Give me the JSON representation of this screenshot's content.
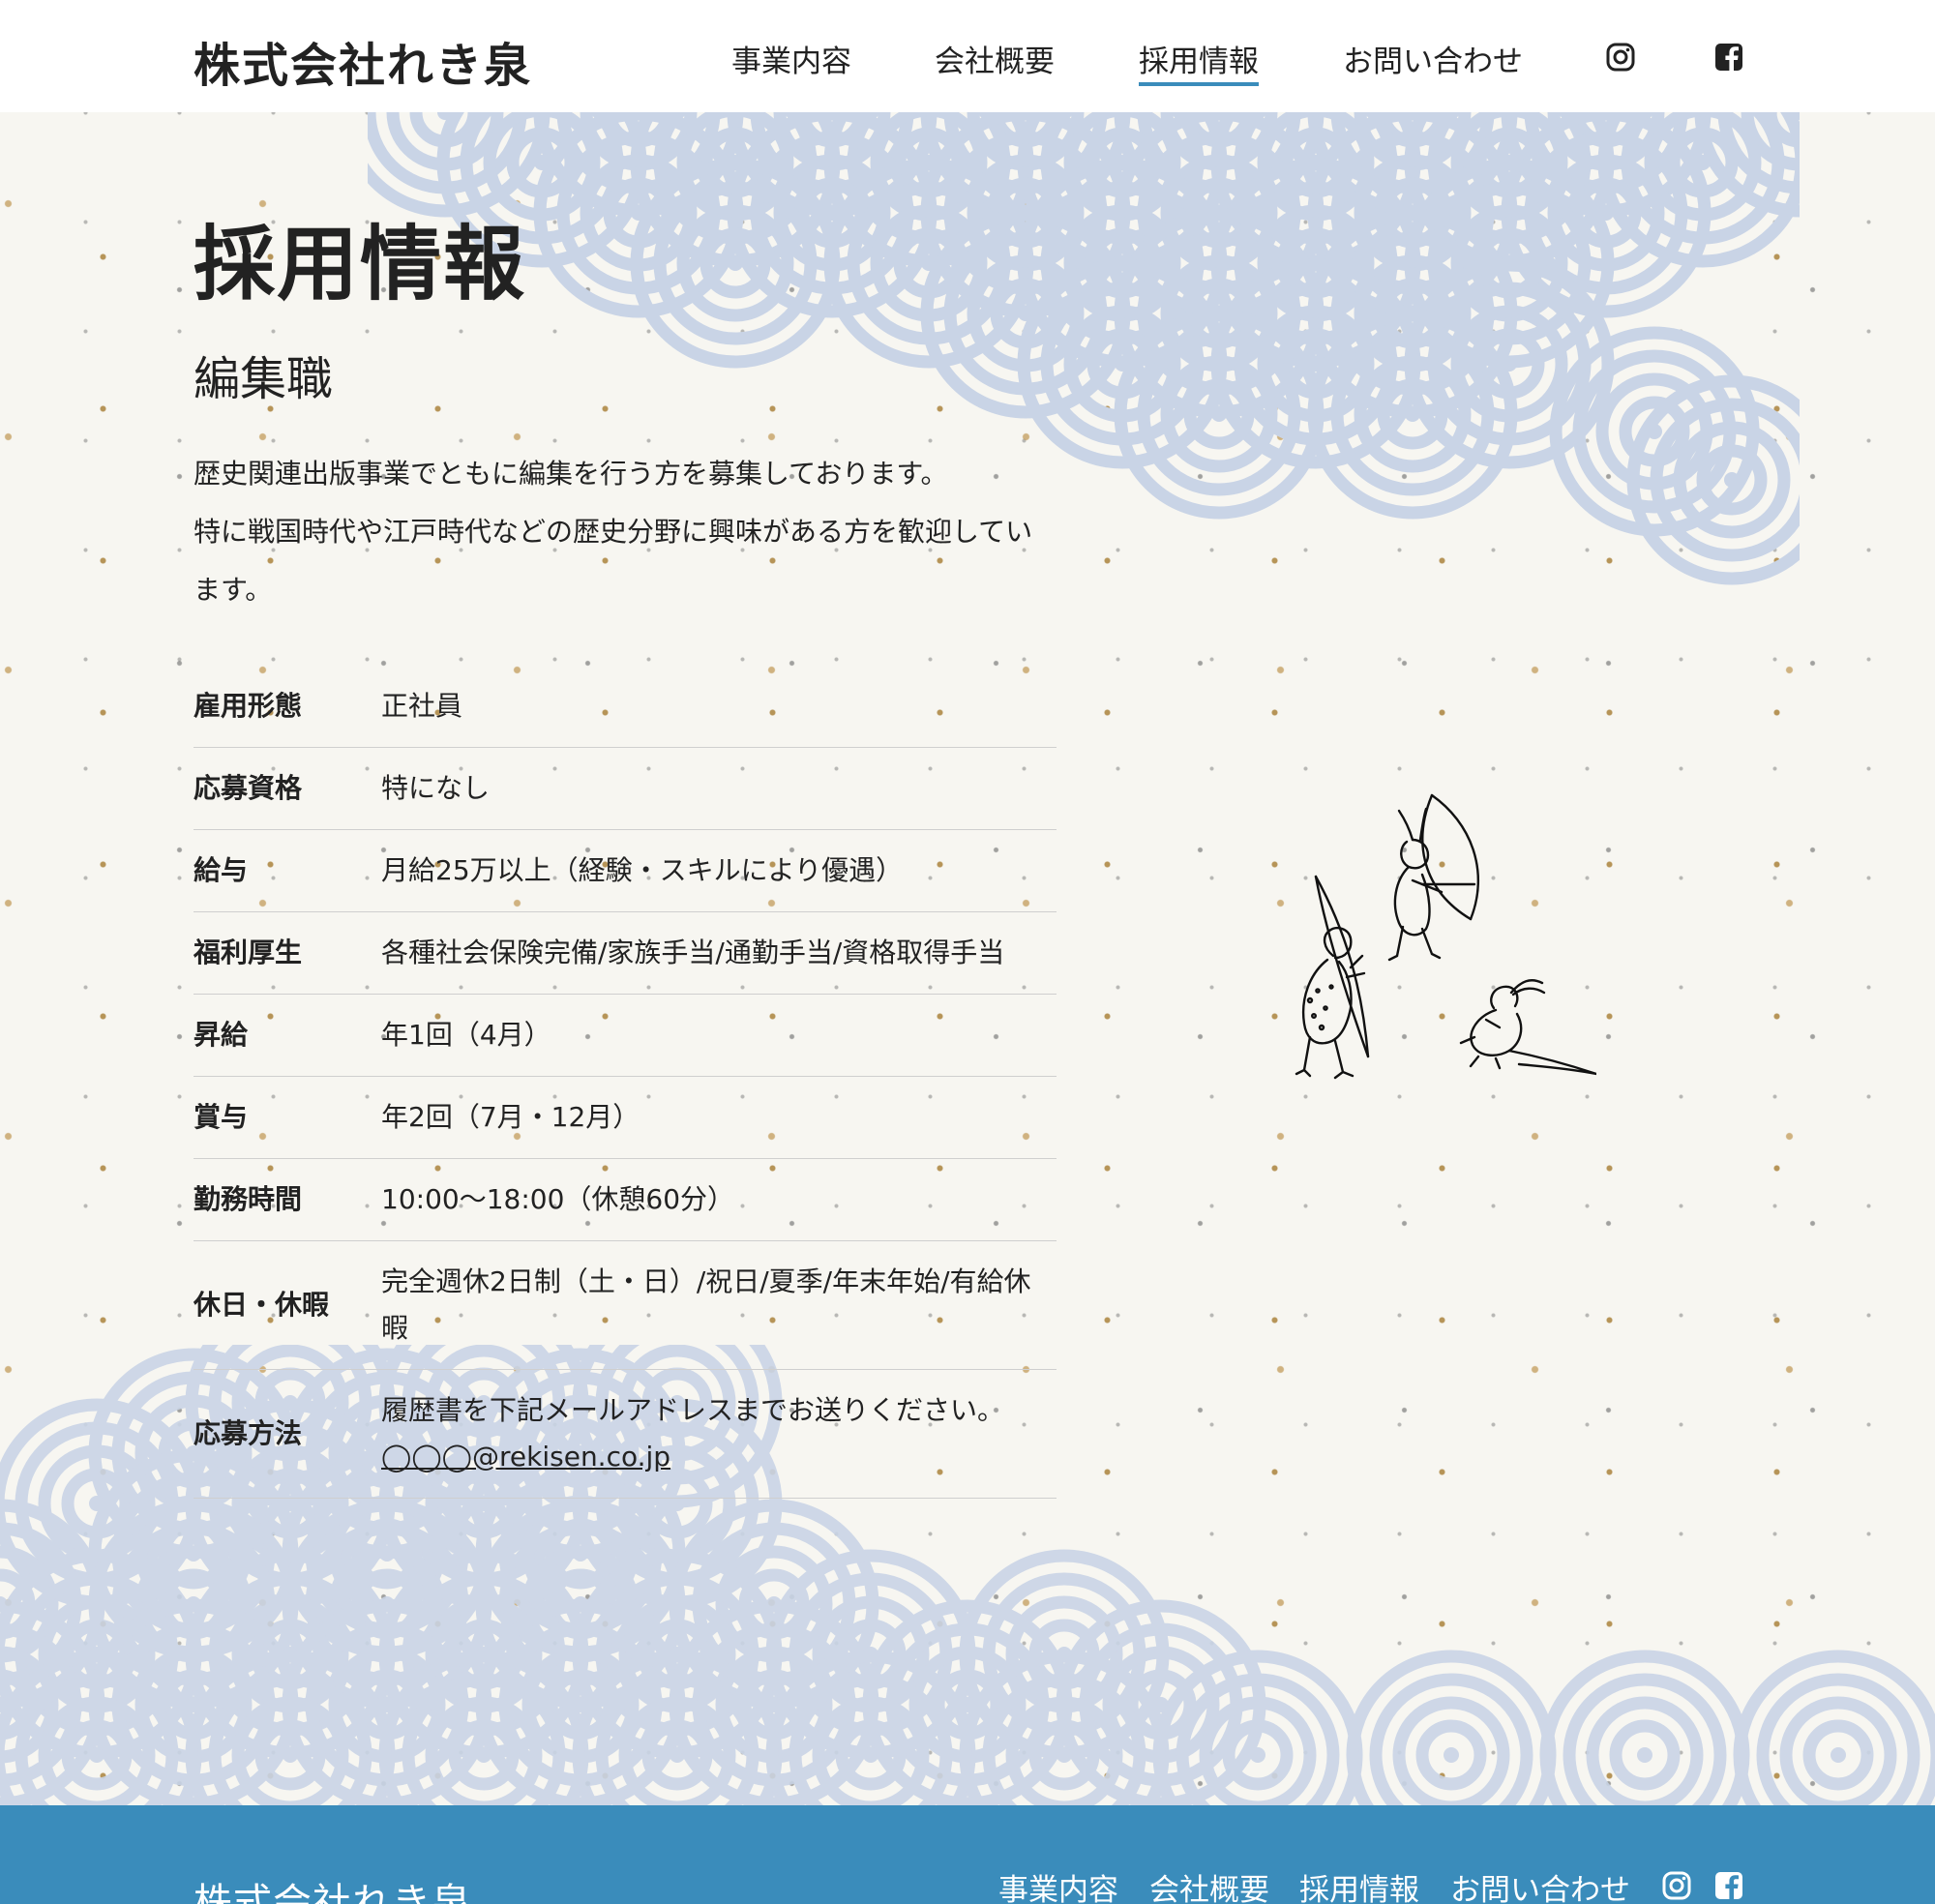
{
  "header": {
    "logo": "株式会社れき泉",
    "nav": [
      "事業内容",
      "会社概要",
      "採用情報",
      "お問い合わせ"
    ],
    "active_nav": "採用情報",
    "icons": [
      "instagram-icon",
      "facebook-icon"
    ]
  },
  "main": {
    "title": "採用情報",
    "job_title": "編集職",
    "description": [
      "歴史関連出版事業でともに編集を行う方を募集しております。",
      "特に戦国時代や江戸時代などの歴史分野に興味がある方を歓迎しています。"
    ],
    "info": [
      {
        "label": "雇用形態",
        "value": "正社員"
      },
      {
        "label": "応募資格",
        "value": "特になし"
      },
      {
        "label": "給与",
        "value": "月給25万以上（経験・スキルにより優遇）"
      },
      {
        "label": "福利厚生",
        "value": "各種社会保険完備/家族手当/通勤手当/資格取得手当"
      },
      {
        "label": "昇給",
        "value": "年1回（4月）"
      },
      {
        "label": "賞与",
        "value": "年2回（7月・12月）"
      },
      {
        "label": "勤務時間",
        "value": "10:00〜18:00（休憩60分）"
      },
      {
        "label": "休日・休暇",
        "value": "完全週休2日制（土・日）/祝日/夏季/年末年始/有給休暇"
      },
      {
        "label": "応募方法",
        "value": "履歴書を下記メールアドレスまでお送りください。",
        "link": "◯◯◯@rekisen.co.jp"
      }
    ]
  },
  "footer": {
    "logo": "株式会社れき泉",
    "nav": [
      "事業内容",
      "会社概要",
      "採用情報",
      "お問い合わせ"
    ]
  },
  "colors": {
    "accent": "#3a8cbb",
    "wave": "#c9d4e6",
    "background": "#f7f6f1",
    "header_bg": "#ffffff",
    "text": "#222222"
  }
}
